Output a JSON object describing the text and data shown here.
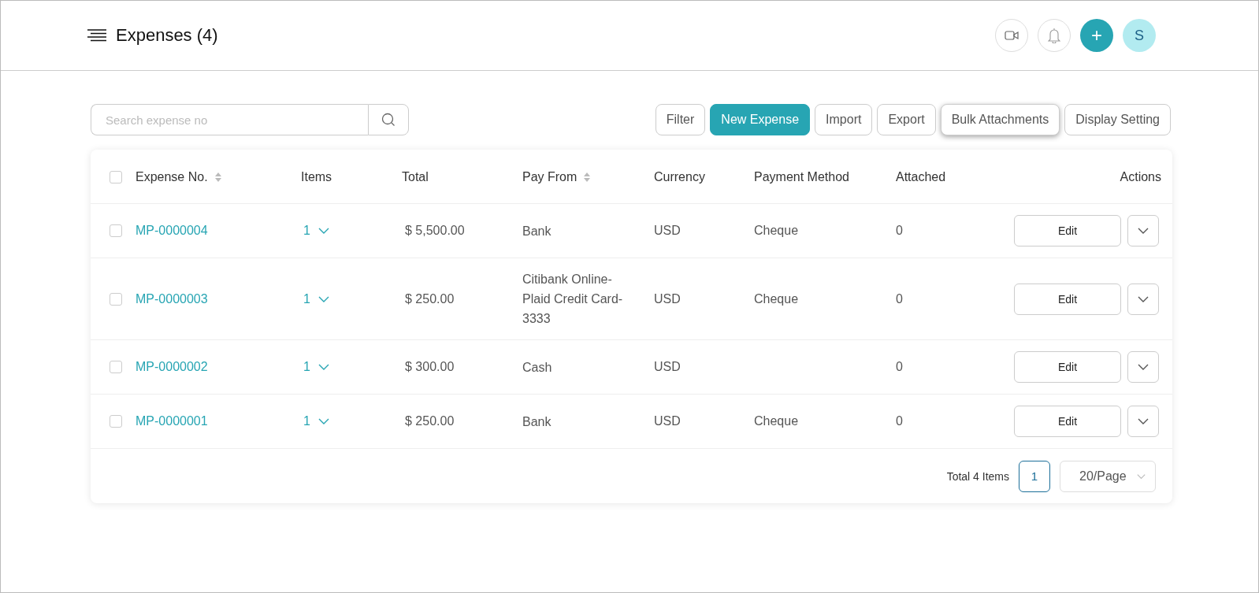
{
  "header": {
    "title": "Expenses (4)",
    "avatar": "S",
    "add_label": "+"
  },
  "search": {
    "placeholder": "Search expense no"
  },
  "toolbar": [
    {
      "label": "Filter",
      "kind": "default",
      "focused": false
    },
    {
      "label": "New Expense",
      "kind": "primary",
      "focused": false
    },
    {
      "label": "Import",
      "kind": "default",
      "focused": false
    },
    {
      "label": "Export",
      "kind": "default",
      "focused": false
    },
    {
      "label": "Bulk Attachments",
      "kind": "default",
      "focused": true
    },
    {
      "label": "Display Setting",
      "kind": "default",
      "focused": false
    }
  ],
  "table": {
    "select_all_checked": false,
    "columns": [
      {
        "label": "Expense No.",
        "sortable": true
      },
      {
        "label": "Items",
        "sortable": false
      },
      {
        "label": "Total",
        "sortable": false
      },
      {
        "label": "Pay From",
        "sortable": true
      },
      {
        "label": "Currency",
        "sortable": false
      },
      {
        "label": "Payment Method",
        "sortable": false
      },
      {
        "label": "Attached",
        "sortable": false
      },
      {
        "label": "Actions",
        "sortable": false
      }
    ],
    "rows": [
      {
        "checked": false,
        "expense_no": "MP-0000004",
        "items": "1",
        "total": "$ 5,500.00",
        "pay_from": "Bank",
        "currency": "USD",
        "payment_method": "Cheque",
        "attached": "0",
        "action": "Edit"
      },
      {
        "checked": false,
        "expense_no": "MP-0000003",
        "items": "1",
        "total": "$ 250.00",
        "pay_from": "Citibank Online-Plaid Credit Card-3333",
        "currency": "USD",
        "payment_method": "Cheque",
        "attached": "0",
        "action": "Edit"
      },
      {
        "checked": false,
        "expense_no": "MP-0000002",
        "items": "1",
        "total": "$ 300.00",
        "pay_from": "Cash",
        "currency": "USD",
        "attached": "0",
        "action": "Edit"
      },
      {
        "checked": false,
        "expense_no": "MP-0000001",
        "items": "1",
        "total": "$ 250.00",
        "pay_from": "Bank",
        "currency": "USD",
        "payment_method": "Cheque",
        "attached": "0",
        "action": "Edit"
      }
    ]
  },
  "pagination": {
    "total": "Total 4 Items",
    "pages": [
      {
        "label": "1",
        "selected": true
      }
    ],
    "page_size": "20/Page"
  }
}
